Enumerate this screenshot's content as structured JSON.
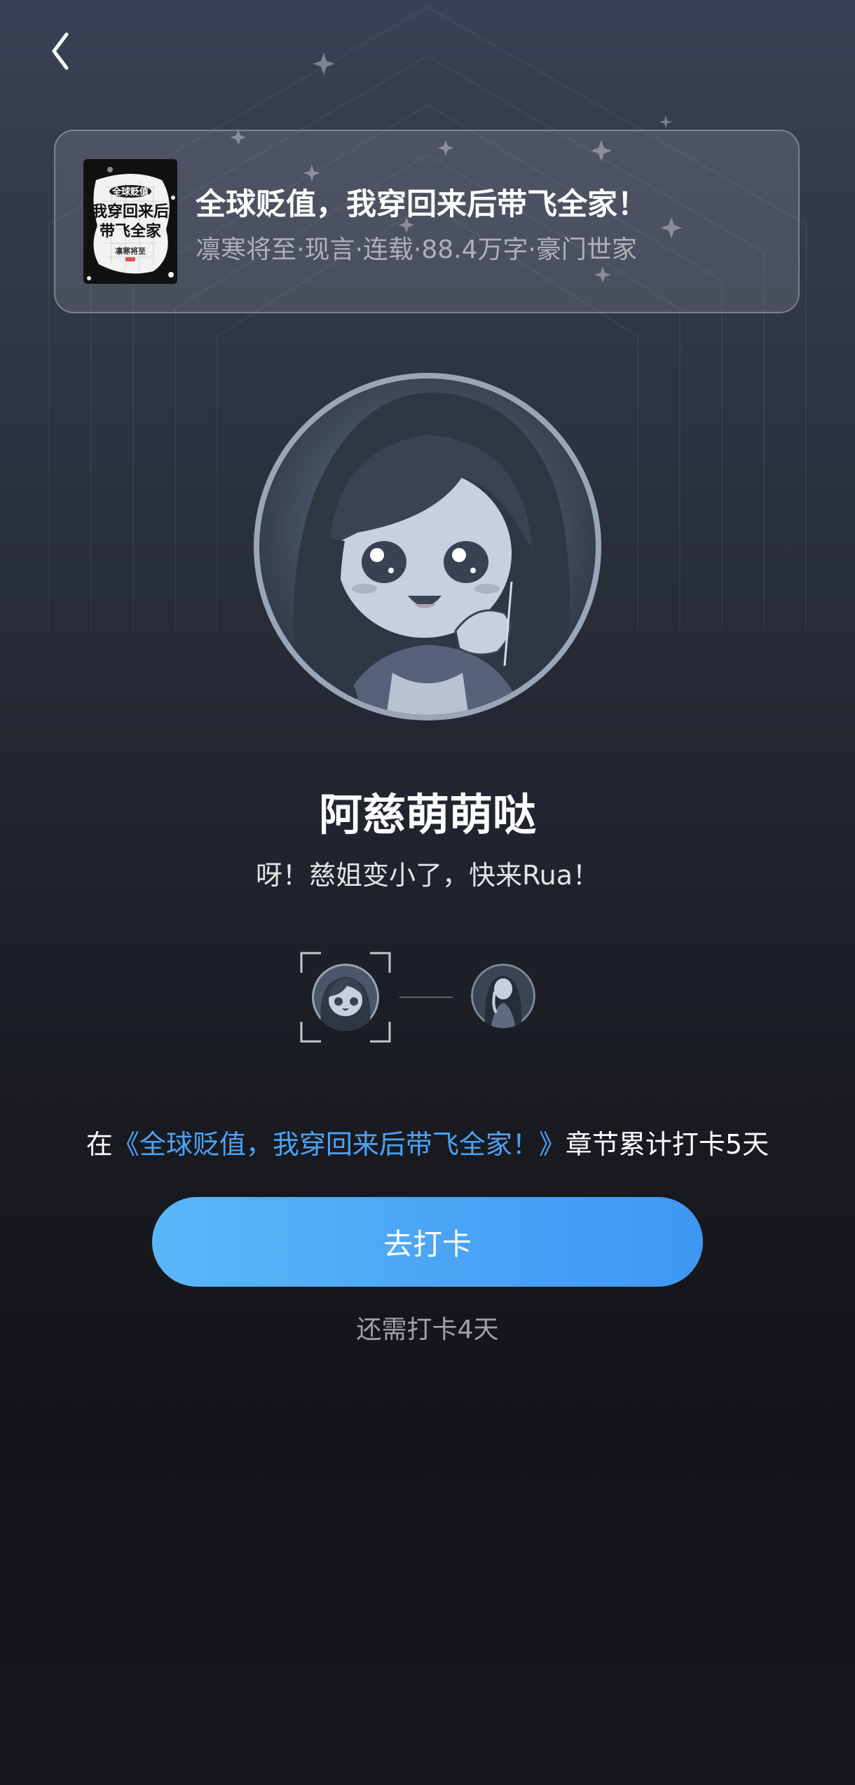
{
  "book": {
    "title": "全球贬值，我穿回来后带飞全家！",
    "meta": "凛寒将至·现言·连载·88.4万字·豪门世家",
    "cover_text_top": "全球贬值",
    "cover_text_line1": "我穿回来后",
    "cover_text_line2": "带飞全家",
    "cover_author": "凛寒将至"
  },
  "character": {
    "name": "阿慈萌萌哒",
    "tagline": "呀！慈姐变小了，快来Rua！"
  },
  "checkin": {
    "prefix": "在",
    "book_link": "《全球贬值，我穿回来后带飞全家！》",
    "suffix": "章节累计打卡5天",
    "button_label": "去打卡",
    "remaining": "还需打卡4天"
  },
  "colors": {
    "accent": "#4aa3f7",
    "button_start": "#5ab7f7",
    "button_end": "#3f97f5"
  },
  "icons": {
    "back": "chevron-left-icon"
  }
}
